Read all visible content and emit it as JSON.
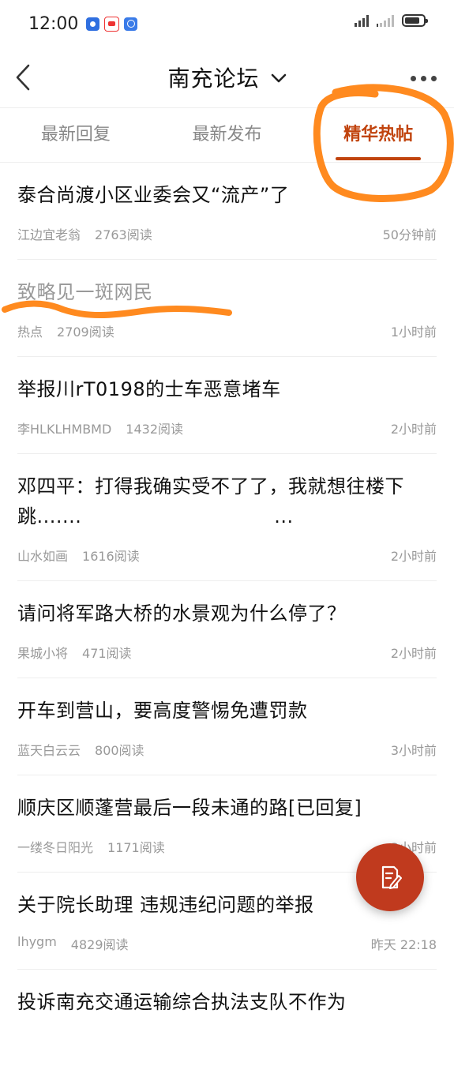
{
  "status_bar": {
    "time": "12:00"
  },
  "header": {
    "title": "南充论坛"
  },
  "tabs": [
    {
      "label": "最新回复"
    },
    {
      "label": "最新发布"
    },
    {
      "label": "精华热帖"
    }
  ],
  "active_tab": 2,
  "posts": [
    {
      "title": "泰合尚渡小区业委会又“流产”了",
      "author": "江边宜老翁",
      "reads": "2763阅读",
      "time": "50分钟前"
    },
    {
      "title": "致略见一斑网民",
      "author": "热点",
      "reads": "2709阅读",
      "time": "1小时前"
    },
    {
      "title": "举报川rT0198的士车恶意堵车",
      "author": "李HLKLHMBMD",
      "reads": "1432阅读",
      "time": "2小时前"
    },
    {
      "title": "邓四平：打得我确实受不了了，我就想往楼下跳.......                              ...",
      "author": "山水如画",
      "reads": "1616阅读",
      "time": "2小时前"
    },
    {
      "title": "请问将军路大桥的水景观为什么停了？",
      "author": "果城小将",
      "reads": "471阅读",
      "time": "2小时前"
    },
    {
      "title": "开车到营山，要高度警惕免遭罚款",
      "author": "蓝天白云云",
      "reads": "800阅读",
      "time": "3小时前"
    },
    {
      "title": "顺庆区顺蓬营最后一段未通的路[已回复]",
      "author": "一缕冬日阳光",
      "reads": "1171阅读",
      "time": "3小时前"
    },
    {
      "title": "关于院长助理 违规违纪问题的举报",
      "author": "lhygm",
      "reads": "4829阅读",
      "time": "昨天 22:18"
    },
    {
      "title": "投诉南充交通运输综合执法支队不作为",
      "author": "",
      "reads": "",
      "time": ""
    }
  ],
  "colors": {
    "accent": "#c1440e",
    "annotation": "#ff8a1f"
  },
  "icons": {
    "back": "chevron-left-icon",
    "dropdown": "chevron-down-icon",
    "more": "more-dots-icon",
    "compose": "compose-icon"
  }
}
